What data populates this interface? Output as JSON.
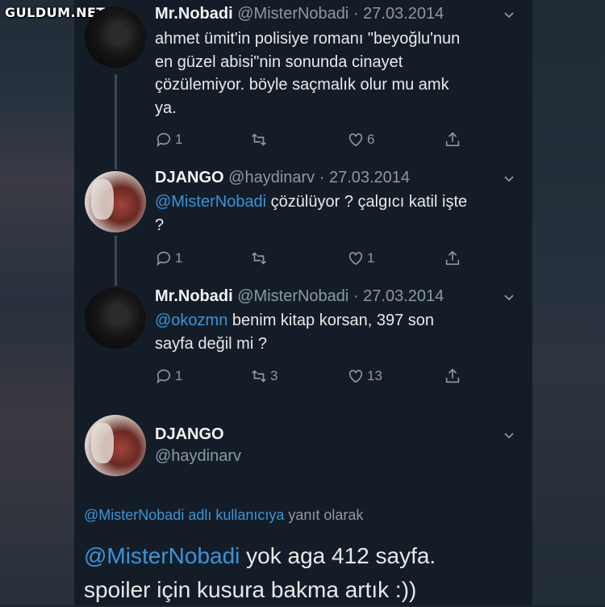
{
  "watermark": "GULDUM.NET",
  "tweets": [
    {
      "name": "Mr.Nobadi",
      "handle": "@MisterNobadi",
      "date": "· 27.03.2014",
      "text_lines": [
        "ahmet ümit'in polisiye romanı \"beyoğlu'nun",
        "en güzel abisi\"nin sonunda cinayet",
        "çözülemiyor. böyle saçmalık olur mu amk",
        "ya."
      ],
      "reply_count": "1",
      "retweet_count": "",
      "like_count": "6"
    },
    {
      "name": "DJANGO",
      "handle": "@haydinarv",
      "date": "· 27.03.2014",
      "mention": "@MisterNobadi",
      "text_rest": " çözülüyor ? çalgıcı katil işte",
      "text_line2": "?",
      "reply_count": "1",
      "retweet_count": "",
      "like_count": "1"
    },
    {
      "name": "Mr.Nobadi",
      "handle": "@MisterNobadi",
      "date": "· 27.03.2014",
      "mention": "@okozmn",
      "text_rest": " benim kitap korsan, 397 son",
      "text_line2": "sayfa değil mi ?",
      "reply_count": "1",
      "retweet_count": "3",
      "like_count": "13"
    }
  ],
  "main_tweet": {
    "name": "DJANGO",
    "handle": "@haydinarv",
    "reply_to_mention": "@MisterNobadi adlı kullanıcıya",
    "reply_to_suffix": " yanıt olarak",
    "mention": "@MisterNobadi",
    "text_rest": " yok aga 412 sayfa.",
    "text_line2": "spoiler için kusura bakma artık :))"
  },
  "colors": {
    "background": "#141d27",
    "mention": "#3b94d9",
    "secondary_text": "#8b98a5",
    "primary_text": "#e7e9ea"
  }
}
